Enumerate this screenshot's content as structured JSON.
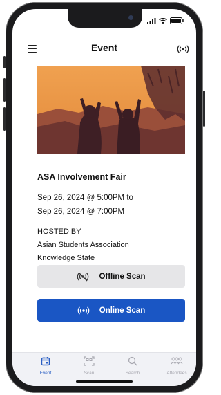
{
  "status_bar": {
    "time": ""
  },
  "nav": {
    "title": "Event"
  },
  "event": {
    "name": "ASA Involvement Fair",
    "start": "Sep 26, 2024 @ 5:00PM to",
    "end": "Sep 26, 2024 @ 7:00PM",
    "hosted_by_label": "HOSTED BY",
    "host_line1": "Asian Students Association",
    "host_line2": "Knowledge State"
  },
  "buttons": {
    "offline": "Offline Scan",
    "online": "Online Scan"
  },
  "tabs": [
    {
      "label": "Event",
      "icon": "calendar-icon",
      "active": true
    },
    {
      "label": "Scan",
      "icon": "qr-scan-icon",
      "active": false
    },
    {
      "label": "Search",
      "icon": "search-icon",
      "active": false
    },
    {
      "label": "Attendees",
      "icon": "people-icon",
      "active": false
    }
  ],
  "colors": {
    "accent": "#1a56c4",
    "image_tint": "#e89a4a",
    "tab_active": "#2a5fc4"
  }
}
